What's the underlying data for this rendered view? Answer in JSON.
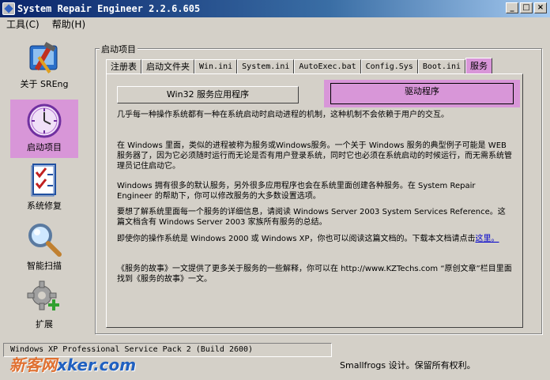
{
  "window": {
    "title": "System Repair Engineer 2.2.6.605"
  },
  "menu": [
    {
      "label": "工具(C)"
    },
    {
      "label": "帮助(H)"
    }
  ],
  "sidebar": [
    {
      "label": "关于 SREng",
      "icon": "tools-icon"
    },
    {
      "label": "启动项目",
      "icon": "clock-icon",
      "active": true
    },
    {
      "label": "系统修复",
      "icon": "checklist-icon"
    },
    {
      "label": "智能扫描",
      "icon": "magnifier-icon"
    },
    {
      "label": "扩展",
      "icon": "gear-plus-icon"
    }
  ],
  "group": {
    "label": "启动项目"
  },
  "tabs": [
    {
      "label": "注册表"
    },
    {
      "label": "启动文件夹"
    },
    {
      "label": "Win.ini"
    },
    {
      "label": "System.ini"
    },
    {
      "label": "AutoExec.bat"
    },
    {
      "label": "Config.Sys"
    },
    {
      "label": "Boot.ini"
    },
    {
      "label": "服务",
      "active": true
    }
  ],
  "buttons": {
    "win32": "Win32 服务应用程序",
    "driver": "驱动程序"
  },
  "paragraphs": {
    "p1": "几乎每一种操作系统都有一种在系统启动时启动进程的机制，这种机制不会依赖于用户的交互。",
    "p2": "在 Windows 里面，类似的进程被称为服务或Windows服务。一个关于 Windows 服务的典型例子可能是 WEB 服务器了，因为它必须随时运行而无论是否有用户登录系统，同时它也必须在系统启动的时候运行，而无需系统管理员记住启动它。",
    "p3": "Windows 拥有很多的默认服务，另外很多应用程序也会在系统里面创建各种服务。在 System Repair Engineer 的帮助下，你可以修改服务的大多数设置选项。",
    "p4": "要想了解系统里面每一个服务的详细信息，请阅读 Windows Server 2003 System Services Reference。这篇文档含有 Windows Server 2003 家族所有服务的总结。",
    "p5_main": "即使你的操作系统是 Windows 2000 或 Windows XP，你也可以阅读这篇文档的。下载本文档请点击",
    "p5_link": "这里。",
    "p6": "《服务的故事》一文提供了更多关于服务的一些解释，你可以在 http://www.KZTechs.com “原创文章”栏目里面找到《服务的故事》一文。"
  },
  "status": {
    "os": "Windows XP Professional Service Pack 2 (Build 2600)",
    "credit": "Smallfrogs 设计。保留所有权利。"
  },
  "watermark": {
    "prefix": "新客网",
    "site": "xker.com"
  },
  "colors": {
    "highlight": "#d896d8",
    "face": "#d4d0c8",
    "title": "#0a246a"
  }
}
